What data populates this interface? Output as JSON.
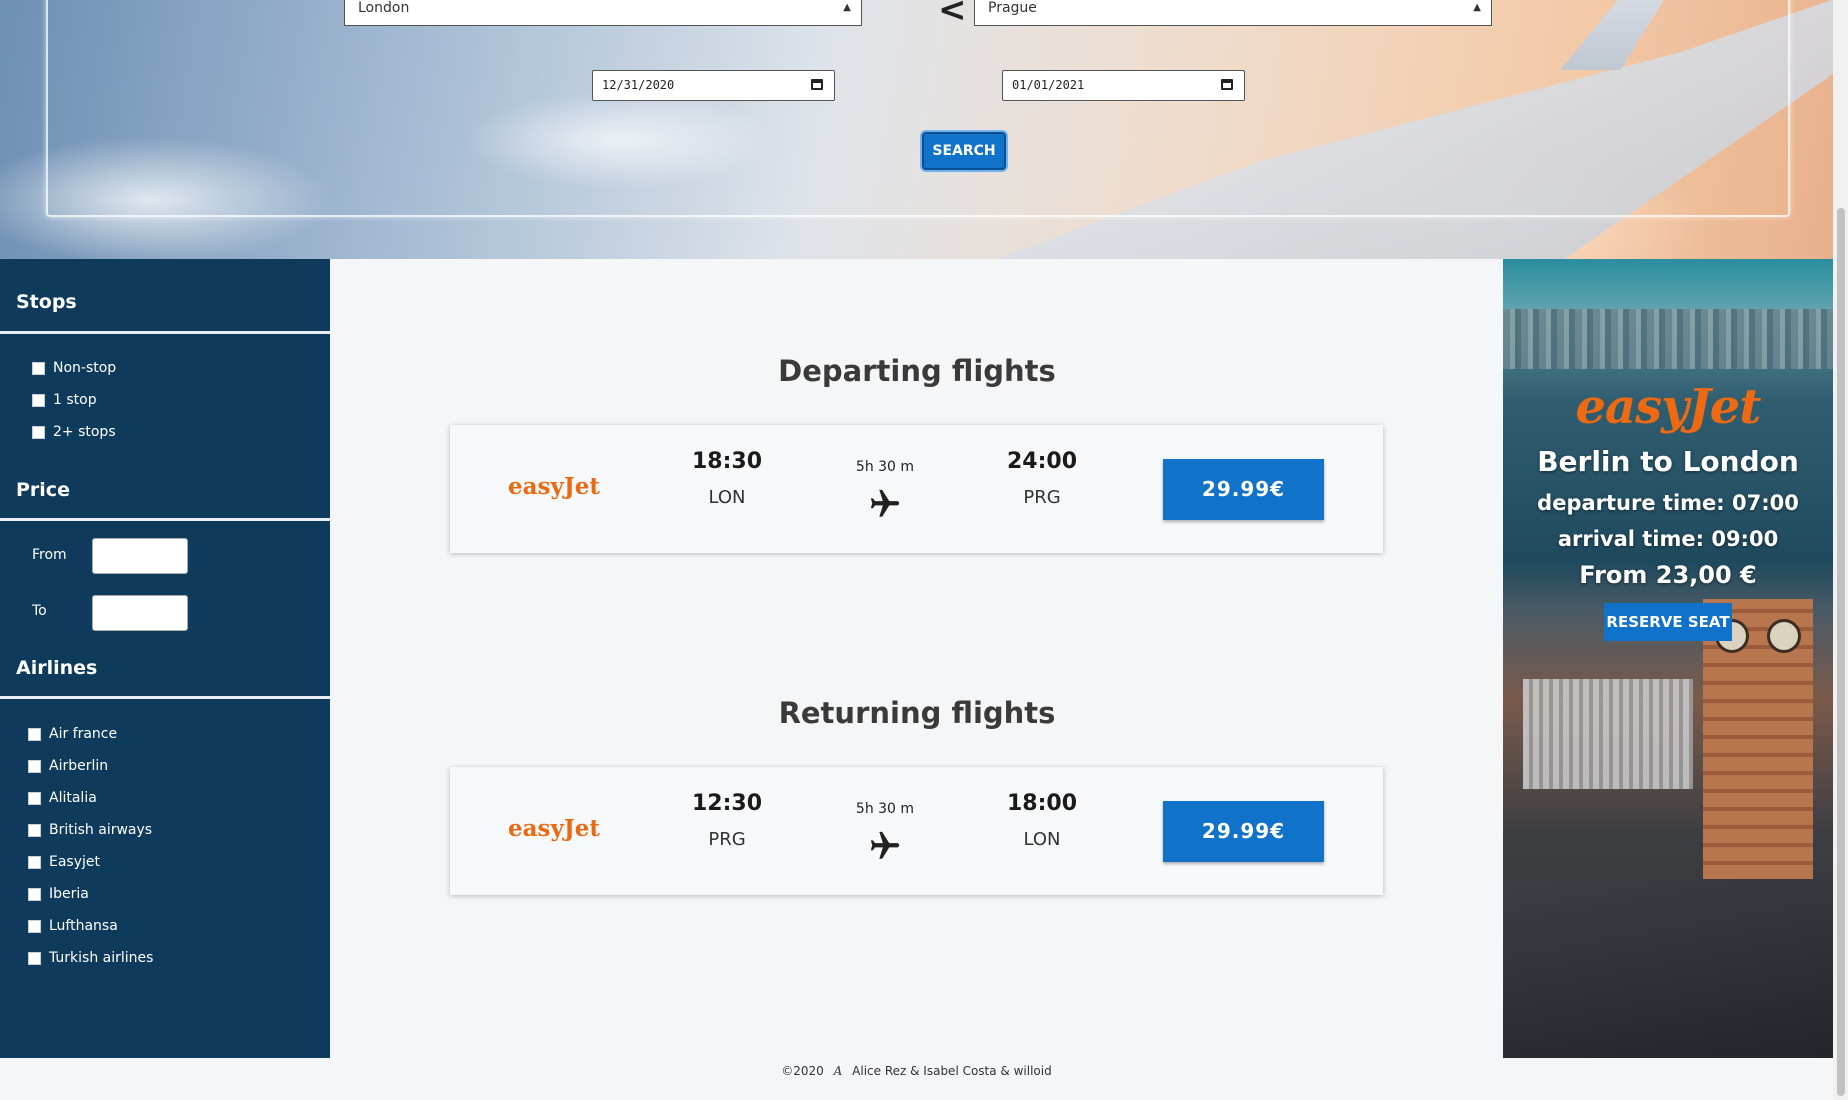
{
  "search": {
    "from_city": "London",
    "to_city": "Prague",
    "swap_symbol": "< >",
    "depart_date": "12/31/2020",
    "return_date": "01/01/2021",
    "search_label": "SEARCH"
  },
  "sidebar": {
    "stops_title": "Stops",
    "stops": [
      "Non-stop",
      "1 stop",
      "2+ stops"
    ],
    "price_title": "Price",
    "price_from_label": "From",
    "price_to_label": "To",
    "airlines_title": "Airlines",
    "airlines": [
      "Air france",
      "Airberlin",
      "Alitalia",
      "British airways",
      "Easyjet",
      "Iberia",
      "Lufthansa",
      "Turkish airlines"
    ]
  },
  "departing": {
    "title": "Departing flights",
    "airline": "easyJet",
    "dep_time": "18:30",
    "dep_code": "LON",
    "duration": "5h 30 m",
    "arr_time": "24:00",
    "arr_code": "PRG",
    "price": "29.99€"
  },
  "returning": {
    "title": "Returning flights",
    "airline": "easyJet",
    "dep_time": "12:30",
    "dep_code": "PRG",
    "duration": "5h 30 m",
    "arr_time": "18:00",
    "arr_code": "LON",
    "price": "29.99€"
  },
  "ad": {
    "brand": "easyJet",
    "route": "Berlin to London",
    "departure": "departure time: 07:00",
    "arrival": "arrival time: 09:00",
    "price": "From 23,00 €",
    "cta": "RESERVE SEAT"
  },
  "footer": {
    "copyright": "©2020",
    "signature": "A",
    "authors": "Alice Rez & Isabel Costa & willoid"
  },
  "colors": {
    "accent": "#1172c9",
    "sidebar_bg": "#0e3a5c",
    "brand_orange": "#ea6a11"
  },
  "icons": {
    "plane": "airplane-icon",
    "calendar": "calendar-icon",
    "select_caret": "sort-caret-icon"
  }
}
